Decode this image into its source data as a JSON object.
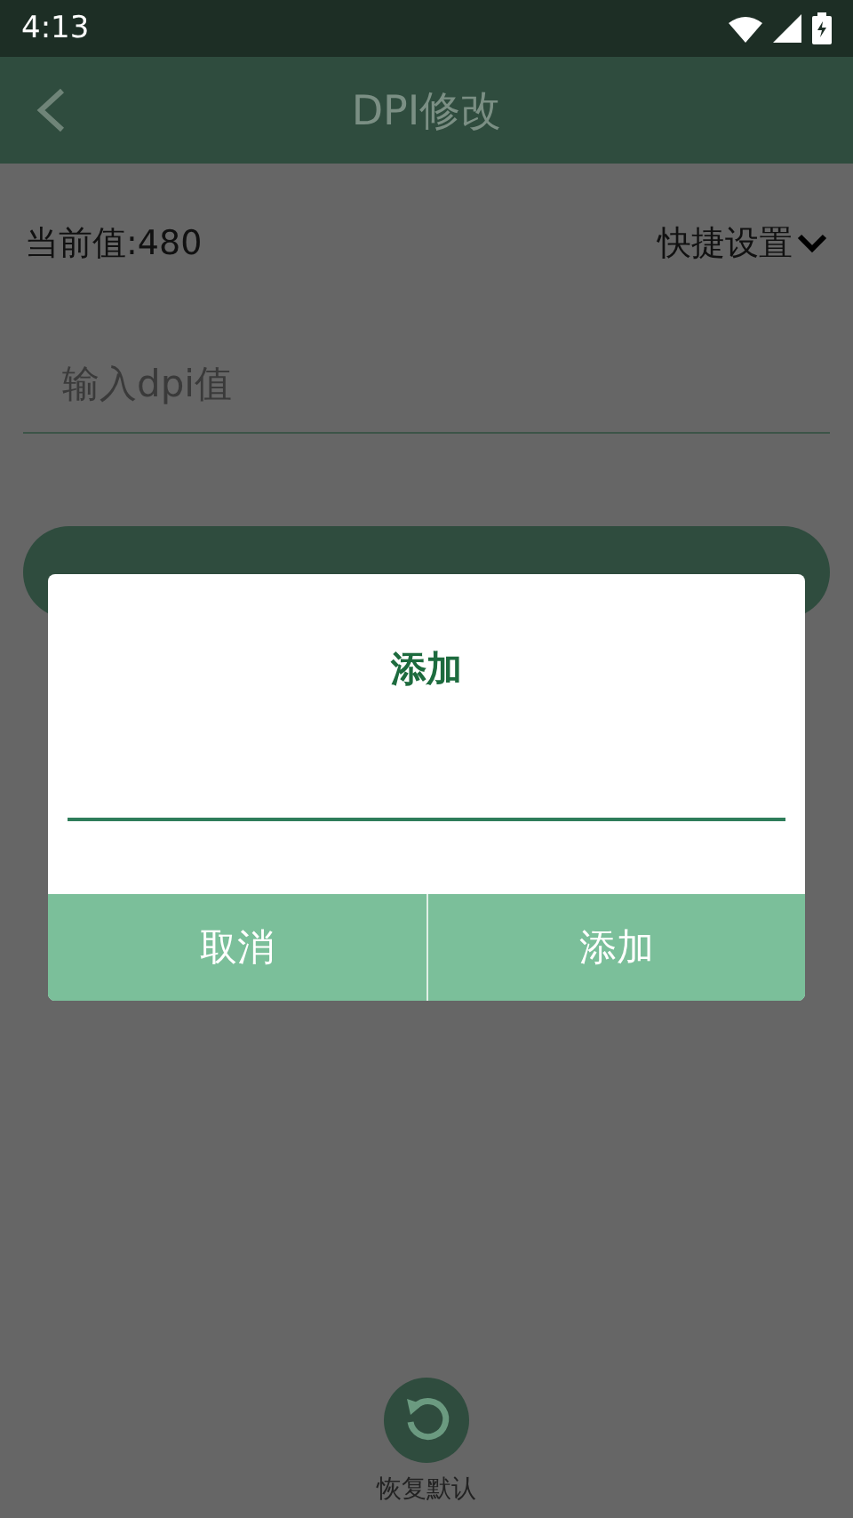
{
  "status_bar": {
    "time": "4:13"
  },
  "toolbar": {
    "title": "DPI修改"
  },
  "current_value": "当前值:480",
  "quick_settings": "快捷设置",
  "dpi_field": {
    "placeholder": "输入dpi值"
  },
  "restore_button": {
    "label": "恢复默认"
  },
  "dialog": {
    "title": "添加",
    "buttons": [
      "取消",
      "添加"
    ]
  }
}
